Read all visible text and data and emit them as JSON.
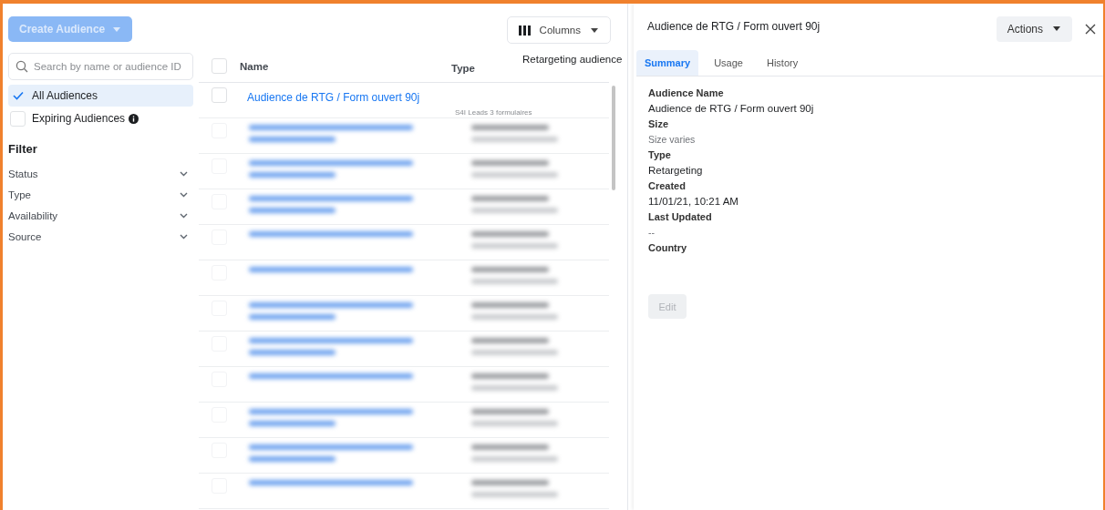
{
  "sidebar": {
    "create_button": {
      "label": "Create Audience",
      "disabled": true
    },
    "search": {
      "placeholder": "Search by name or audience ID"
    },
    "views": [
      {
        "label": "All Audiences",
        "selected": true,
        "info": false
      },
      {
        "label": "Expiring Audiences",
        "selected": false,
        "info": true
      }
    ],
    "filter_title": "Filter",
    "filters": [
      {
        "label": "Status"
      },
      {
        "label": "Type"
      },
      {
        "label": "Availability"
      },
      {
        "label": "Source"
      }
    ]
  },
  "table": {
    "columns_button": "Columns",
    "select_all_checked": false,
    "columns": [
      "Name",
      "Type",
      "Retargeting audience"
    ],
    "rows": [
      {
        "name": "Audience de RTG / Form ouvert 90j",
        "type_detail": "S4I Leads 3 formulaires",
        "checked": false
      }
    ],
    "redacted_rows": [
      {
        "kind": "two-line",
        "checked": false
      },
      {
        "kind": "two-line",
        "checked": false
      },
      {
        "kind": "two-line",
        "checked": false
      },
      {
        "kind": "one-line",
        "checked": false
      },
      {
        "kind": "one-line",
        "checked": false
      },
      {
        "kind": "two-line",
        "checked": false
      },
      {
        "kind": "two-line",
        "checked": false
      },
      {
        "kind": "one-line",
        "checked": false
      },
      {
        "kind": "two-line",
        "checked": false
      },
      {
        "kind": "two-line",
        "checked": false
      },
      {
        "kind": "one-line",
        "checked": false
      }
    ]
  },
  "detail": {
    "title": "Audience de RTG / Form ouvert 90j",
    "actions_button": "Actions",
    "tabs": [
      {
        "label": "Summary",
        "selected": true
      },
      {
        "label": "Usage",
        "selected": false
      },
      {
        "label": "History",
        "selected": false
      }
    ],
    "fields": [
      {
        "label": "Audience Name",
        "value": "Audience de RTG / Form ouvert 90j",
        "muted": false
      },
      {
        "label": "Size",
        "value": "Size varies",
        "muted": true
      },
      {
        "label": "Type",
        "value": "Retargeting",
        "muted": false
      },
      {
        "label": "Created",
        "value": "11/01/21, 10:21 AM",
        "muted": false
      },
      {
        "label": "Last Updated",
        "value": "--",
        "muted": true
      },
      {
        "label": "Country"
      }
    ],
    "edit_button": {
      "label": "Edit",
      "disabled": true
    }
  }
}
